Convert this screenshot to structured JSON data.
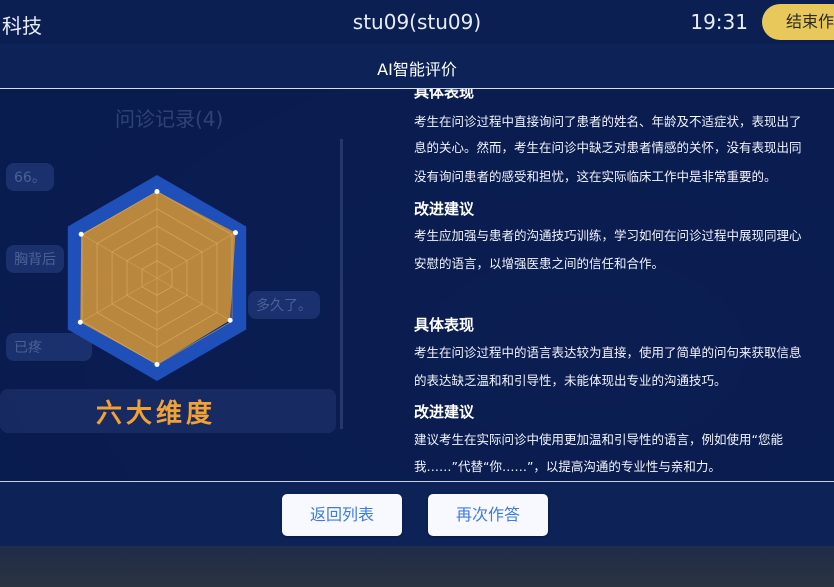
{
  "topbar": {
    "brand": "科技",
    "session": "stu09(stu09)",
    "clock": "19:31",
    "end_button": "结束作答"
  },
  "modal": {
    "title": "AI智能评价"
  },
  "background_chat": {
    "title": "问诊记录(4)",
    "bubbles": [
      "66。",
      "胸背后",
      "多久了。",
      "已疼"
    ]
  },
  "radar": {
    "label": "六大维度",
    "axes": 6,
    "levels": 5,
    "values": [
      0.84,
      0.88,
      0.82,
      0.84,
      0.86,
      0.85
    ],
    "colors": {
      "fill": "#c88f38",
      "outer": "#1f4fb8",
      "ring": "#0d2a73"
    }
  },
  "feedback": {
    "section1_head_partial": "具体表现",
    "section1_text": [
      "考生在问诊过程中直接询问了患者的姓名、年龄及不适症状，表现出了",
      "息的关心。然而，考生在问诊中缺乏对患者情感的关怀，没有表现出同",
      "没有询问患者的感受和担忧，这在实际临床工作中是非常重要的。"
    ],
    "section2_head": "改进建议",
    "section2_text": [
      "考生应加强与患者的沟通技巧训练，学习如何在问诊过程中展现同理心",
      "安慰的语言，以增强医患之间的信任和合作。"
    ],
    "section3_head": "具体表现",
    "section3_text": [
      "考生在问诊过程中的语言表达较为直接，使用了简单的问句来获取信息",
      "的表达缺乏温和和引导性，未能体现出专业的沟通技巧。"
    ],
    "section4_head": "改进建议",
    "section4_text": [
      "建议考生在实际问诊中使用更加温和引导性的语言，例如使用“您能",
      "我……”代替“你……”，以提高沟通的专业性与亲和力。"
    ]
  },
  "footer": {
    "back_button": "返回列表",
    "retry_button": "再次作答"
  }
}
